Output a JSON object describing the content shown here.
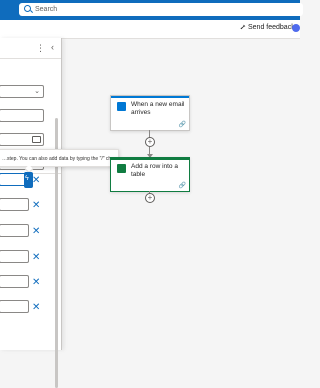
{
  "topbar": {
    "search_placeholder": "Search",
    "accent": "#0f6cbd"
  },
  "commandbar": {
    "feedback_label": "Send feedback"
  },
  "panel": {
    "more_icon": "⋮",
    "collapse_icon": "‹",
    "tooltip_text": "…step. You can also add data by typing the \"/\" character",
    "dynamic_button_glyph": "ϟ",
    "remove_glyph": "✕"
  },
  "flow": {
    "trigger": {
      "title": "When a new email arrives",
      "color": "#0078d4",
      "icon": "outlook-icon"
    },
    "action": {
      "title": "Add a row into a table",
      "color": "#107c41",
      "icon": "excel-icon"
    },
    "link_glyph": "🔗",
    "plus_glyph": "+"
  }
}
